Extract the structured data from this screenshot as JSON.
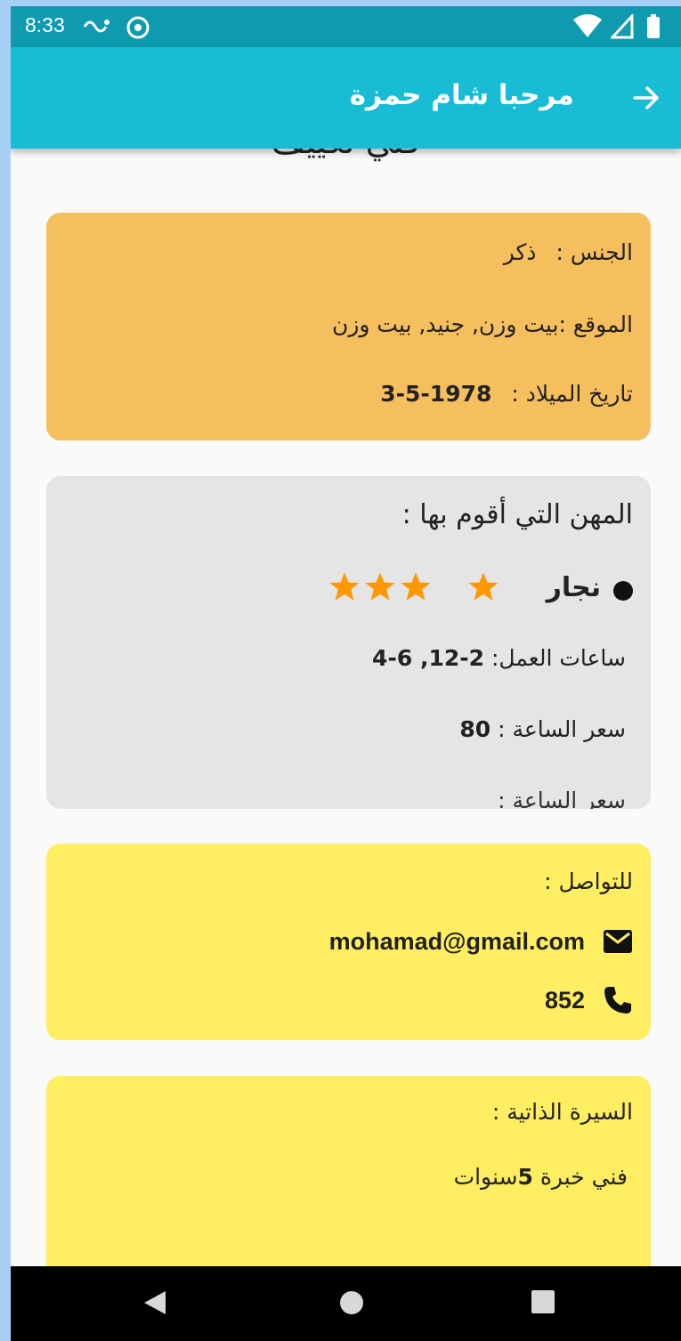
{
  "status_bar": {
    "time": "8:33",
    "icons": [
      "notification-icon",
      "sync-icon",
      "wifi-icon",
      "signal-icon",
      "battery-icon"
    ]
  },
  "app_bar": {
    "title": "مرحبا شام حمزة",
    "back_icon": "arrow-right-icon"
  },
  "profile": {
    "cut_heading": "فني تكييف"
  },
  "info_card": {
    "gender_label": "الجنس :",
    "gender_value": "ذكر",
    "location_label": "الموقع :",
    "location_value": "بيت وزن, جنيد, بيت وزن",
    "birth_label": "تاريخ الميلاد :",
    "birth_value": "1978-5-3",
    "color": "#f6bf5e"
  },
  "jobs_card": {
    "heading": "المهن التي أقوم بها :",
    "jobs": [
      {
        "name": "نجار",
        "rating": 4,
        "hours_label": "ساعات العمل:",
        "hours_value": "2-12, 6-4",
        "price_label": "سعر الساعة :",
        "price_value": "80"
      }
    ],
    "color": "#e5e5e5"
  },
  "contact_card": {
    "heading": "للتواصل :",
    "email": "mohamad@gmail.com",
    "email_icon": "mail-icon",
    "phone": "852",
    "phone_icon": "phone-icon",
    "color": "#ffee62"
  },
  "bio_card": {
    "heading": "السيرة الذاتية :",
    "text_prefix": "فني خبرة ",
    "years": "5",
    "text_suffix": "سنوات",
    "color": "#ffee62"
  },
  "colors": {
    "app_bar": "#17bcd5",
    "status_bar": "#0e9bb0",
    "star": "#ff9800"
  },
  "nav_bar": {
    "icons": [
      "back-triangle-icon",
      "home-circle-icon",
      "recents-square-icon"
    ]
  }
}
